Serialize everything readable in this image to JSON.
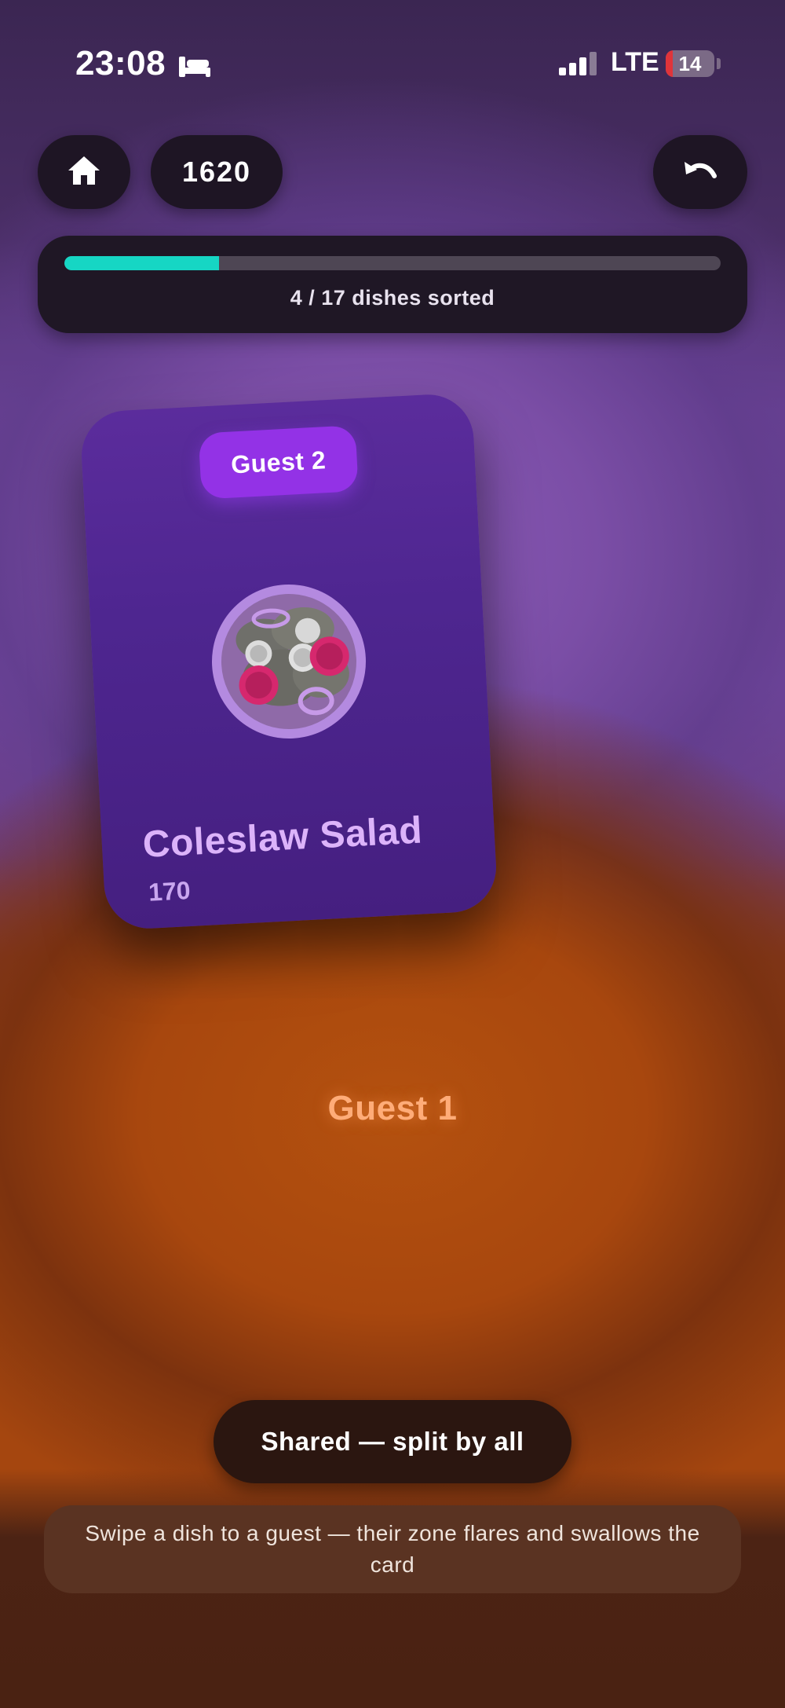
{
  "status_bar": {
    "time": "23:08",
    "focus_icon": "bed-icon",
    "signal_icon": "cellular-signal-icon",
    "network": "LTE",
    "battery_level": "14",
    "battery_fraction": 0.14,
    "battery_color": "#e0343a"
  },
  "toolbar": {
    "home_icon": "home-icon",
    "score": "1620",
    "undo_icon": "undo-icon"
  },
  "progress": {
    "label": "4 / 17 dishes sorted",
    "sorted": 4,
    "total": 17,
    "fill_color": "#16d6c4"
  },
  "card": {
    "guest_tag": "Guest 2",
    "dish_name": "Coleslaw Salad",
    "dish_price": "170",
    "image_icon": "salad-bowl-icon",
    "color": "#5b2c9c"
  },
  "zone": {
    "label": "Guest 1",
    "color": "#a8470e"
  },
  "shared_button": {
    "label": "Shared — split by all"
  },
  "hint": {
    "text": "Swipe a dish to a guest — their zone flares and swallows the card"
  }
}
